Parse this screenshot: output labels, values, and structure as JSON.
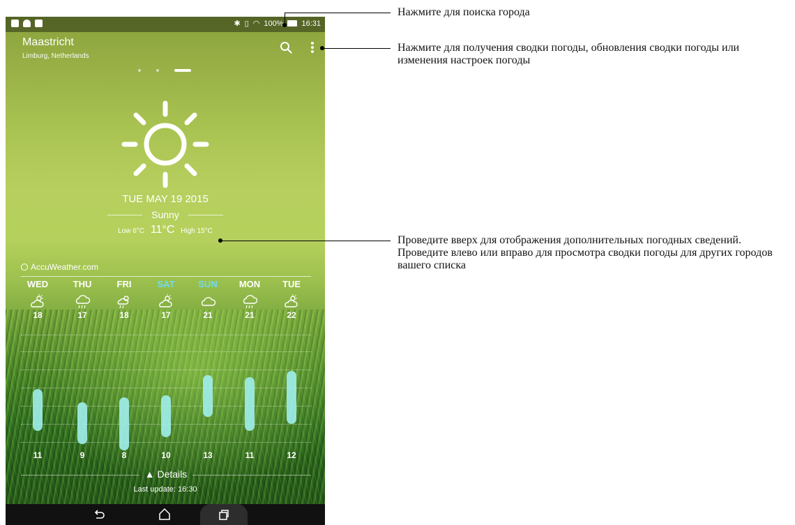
{
  "status_bar": {
    "battery": "100%",
    "time": "16:31"
  },
  "header": {
    "city": "Maastricht",
    "region": "Limburg, Netherlands",
    "search_icon": "search-icon",
    "menu_icon": "more-vert-icon"
  },
  "pager": {
    "pages": 3,
    "active_index": 2
  },
  "current": {
    "icon": "sun-icon",
    "date": "TUE MAY 19 2015",
    "condition": "Sunny",
    "low_label": "Low 6°C",
    "temp": "11°C",
    "high_label": "High 15°C"
  },
  "provider": "AccuWeather.com",
  "forecast": [
    {
      "day": "WED",
      "icon": "partly-sunny-icon",
      "high": "18",
      "low": "11",
      "weekend": false
    },
    {
      "day": "THU",
      "icon": "rain-icon",
      "high": "17",
      "low": "9",
      "weekend": false
    },
    {
      "day": "FRI",
      "icon": "sun-rain-icon",
      "high": "18",
      "low": "8",
      "weekend": false
    },
    {
      "day": "SAT",
      "icon": "partly-sunny-icon",
      "high": "17",
      "low": "10",
      "weekend": true
    },
    {
      "day": "SUN",
      "icon": "cloud-icon",
      "high": "21",
      "low": "13",
      "weekend": true
    },
    {
      "day": "MON",
      "icon": "rain-icon",
      "high": "21",
      "low": "11",
      "weekend": false
    },
    {
      "day": "TUE",
      "icon": "partly-sunny-icon",
      "high": "22",
      "low": "12",
      "weekend": false
    }
  ],
  "details_label": "Details",
  "last_update": "Last update: 16:30",
  "callouts": {
    "search": "Нажмите для поиска города",
    "menu": "Нажмите для получения сводки погоды, обновления сводки погоды или изменения настроек погоды",
    "swipe_1": "Проведите вверх для отображения дополнительных погодных сведений.",
    "swipe_2": "Проведите влево или вправо для просмотра сводки погоды для других городов вашего списка"
  },
  "colors": {
    "weekend": "#6fdcef",
    "bar": "#a0eeec"
  }
}
